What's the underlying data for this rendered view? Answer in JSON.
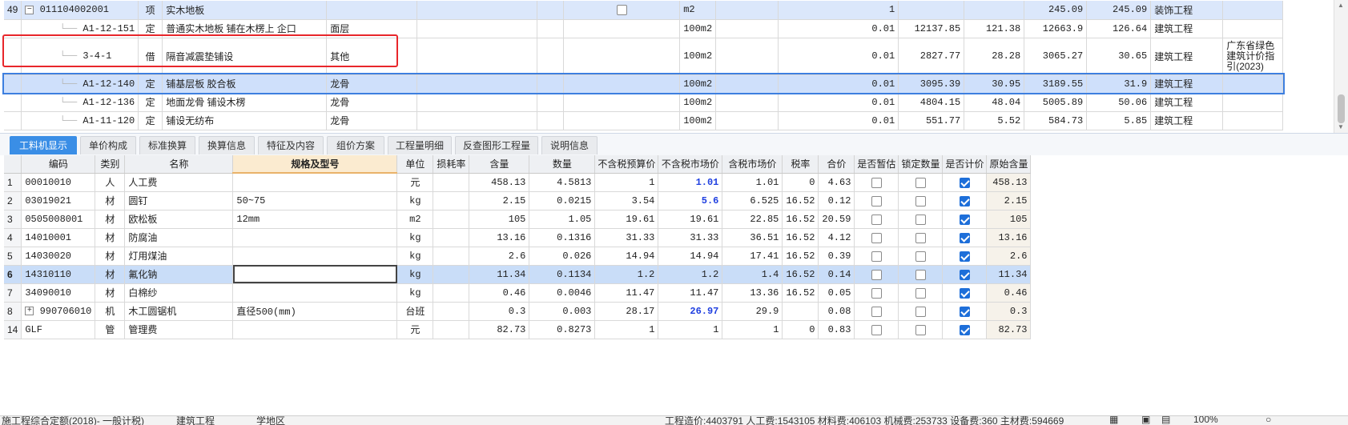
{
  "top_rows": [
    {
      "seq": "49",
      "code": "011104002001",
      "type": "项",
      "name": "实木地板",
      "part": "",
      "unit": "m2",
      "qty": "1",
      "price": "",
      "total": "",
      "c1": "245.09",
      "c2": "245.09",
      "discipline": "装饰工程",
      "note": ""
    },
    {
      "seq": "",
      "code": "A1-12-151",
      "type": "定",
      "name": "普通实木地板 铺在木楞上 企口",
      "part": "面层",
      "unit": "100m2",
      "qty": "0.01",
      "price": "12137.85",
      "total": "121.38",
      "c1": "12663.9",
      "c2": "126.64",
      "discipline": "建筑工程",
      "note": ""
    },
    {
      "seq": "",
      "code": "3-4-1",
      "type": "借",
      "name": "隔音减震垫铺设",
      "part": "其他",
      "unit": "100m2",
      "qty": "0.01",
      "price": "2827.77",
      "total": "28.28",
      "c1": "3065.27",
      "c2": "30.65",
      "discipline": "建筑工程",
      "note": "广东省绿色建筑计价指引(2023)"
    },
    {
      "seq": "",
      "code": "A1-12-140",
      "type": "定",
      "name": "铺基层板 胶合板",
      "part": "龙骨",
      "unit": "100m2",
      "qty": "0.01",
      "price": "3095.39",
      "total": "30.95",
      "c1": "3189.55",
      "c2": "31.9",
      "discipline": "建筑工程",
      "note": ""
    },
    {
      "seq": "",
      "code": "A1-12-136",
      "type": "定",
      "name": "地面龙骨 铺设木楞",
      "part": "龙骨",
      "unit": "100m2",
      "qty": "0.01",
      "price": "4804.15",
      "total": "48.04",
      "c1": "5005.89",
      "c2": "50.06",
      "discipline": "建筑工程",
      "note": ""
    },
    {
      "seq": "",
      "code": "A1-11-120",
      "type": "定",
      "name": "铺设无纺布",
      "part": "龙骨",
      "unit": "100m2",
      "qty": "0.01",
      "price": "551.77",
      "total": "5.52",
      "c1": "584.73",
      "c2": "5.85",
      "discipline": "建筑工程",
      "note": ""
    }
  ],
  "tabs": [
    "工料机显示",
    "单价构成",
    "标准换算",
    "换算信息",
    "特征及内容",
    "组价方案",
    "工程量明细",
    "反查图形工程量",
    "说明信息"
  ],
  "columns": [
    "编码",
    "类别",
    "名称",
    "规格及型号",
    "单位",
    "损耗率",
    "含量",
    "数量",
    "不含税预算价",
    "不含税市场价",
    "含税市场价",
    "税率",
    "合价",
    "是否暂估",
    "锁定数量",
    "是否计价",
    "原始含量"
  ],
  "materials": [
    {
      "no": "1",
      "code": "00010010",
      "cat": "人",
      "name": "人工费",
      "spec": "",
      "unit": "元",
      "loss": "",
      "content": "458.13",
      "qty": "4.5813",
      "budget": "1",
      "market": "1.01",
      "market_tax": "1.01",
      "tax": "0",
      "sum": "4.63",
      "est": false,
      "lock": false,
      "priced": true,
      "orig": "458.13"
    },
    {
      "no": "2",
      "code": "03019021",
      "cat": "材",
      "name": "圆钉",
      "spec": "50~75",
      "unit": "kg",
      "loss": "",
      "content": "2.15",
      "qty": "0.0215",
      "budget": "3.54",
      "market": "5.6",
      "market_tax": "6.525",
      "tax": "16.52",
      "sum": "0.12",
      "est": false,
      "lock": false,
      "priced": true,
      "orig": "2.15"
    },
    {
      "no": "3",
      "code": "0505008001",
      "cat": "材",
      "name": "欧松板",
      "spec": "12mm",
      "unit": "m2",
      "loss": "",
      "content": "105",
      "qty": "1.05",
      "budget": "19.61",
      "market": "19.61",
      "market_tax": "22.85",
      "tax": "16.52",
      "sum": "20.59",
      "est": false,
      "lock": false,
      "priced": true,
      "orig": "105"
    },
    {
      "no": "4",
      "code": "14010001",
      "cat": "材",
      "name": "防腐油",
      "spec": "",
      "unit": "kg",
      "loss": "",
      "content": "13.16",
      "qty": "0.1316",
      "budget": "31.33",
      "market": "31.33",
      "market_tax": "36.51",
      "tax": "16.52",
      "sum": "4.12",
      "est": false,
      "lock": false,
      "priced": true,
      "orig": "13.16"
    },
    {
      "no": "5",
      "code": "14030020",
      "cat": "材",
      "name": "灯用煤油",
      "spec": "",
      "unit": "kg",
      "loss": "",
      "content": "2.6",
      "qty": "0.026",
      "budget": "14.94",
      "market": "14.94",
      "market_tax": "17.41",
      "tax": "16.52",
      "sum": "0.39",
      "est": false,
      "lock": false,
      "priced": true,
      "orig": "2.6"
    },
    {
      "no": "6",
      "code": "14310110",
      "cat": "材",
      "name": "氟化钠",
      "spec": "",
      "unit": "kg",
      "loss": "",
      "content": "11.34",
      "qty": "0.1134",
      "budget": "1.2",
      "market": "1.2",
      "market_tax": "1.4",
      "tax": "16.52",
      "sum": "0.14",
      "est": false,
      "lock": false,
      "priced": true,
      "orig": "11.34"
    },
    {
      "no": "7",
      "code": "34090010",
      "cat": "材",
      "name": "白棉纱",
      "spec": "",
      "unit": "kg",
      "loss": "",
      "content": "0.46",
      "qty": "0.0046",
      "budget": "11.47",
      "market": "11.47",
      "market_tax": "13.36",
      "tax": "16.52",
      "sum": "0.05",
      "est": false,
      "lock": false,
      "priced": true,
      "orig": "0.46"
    },
    {
      "no": "8",
      "code": "990706010",
      "cat": "机",
      "name": "木工圆锯机",
      "spec": "直径500(mm)",
      "unit": "台班",
      "loss": "",
      "content": "0.3",
      "qty": "0.003",
      "budget": "28.17",
      "market": "26.97",
      "market_tax": "29.9",
      "tax": "",
      "sum": "0.08",
      "est": false,
      "lock": false,
      "priced": true,
      "orig": "0.3"
    },
    {
      "no": "14",
      "code": "GLF",
      "cat": "管",
      "name": "管理费",
      "spec": "",
      "unit": "元",
      "loss": "",
      "content": "82.73",
      "qty": "0.8273",
      "budget": "1",
      "market": "1",
      "market_tax": "1",
      "tax": "0",
      "sum": "0.83",
      "est": false,
      "lock": false,
      "priced": true,
      "orig": "82.73"
    }
  ],
  "blue_market_rows": [
    "1",
    "2",
    "8"
  ],
  "selected_material_row": "6",
  "status": {
    "left": "施工程综合定额(2018)- 一般计税)",
    "mid1": "建筑工程",
    "mid2": "学地区",
    "summary": "工程造价:4403791  人工费:1543105  材料费:406103  机械费:253733  设备费:360  主材费:594669",
    "zoom": "100%"
  },
  "colors": {
    "accent": "#3a8ee6",
    "highlight_box": "#e8262b",
    "blue_value": "#1f3fe0"
  }
}
